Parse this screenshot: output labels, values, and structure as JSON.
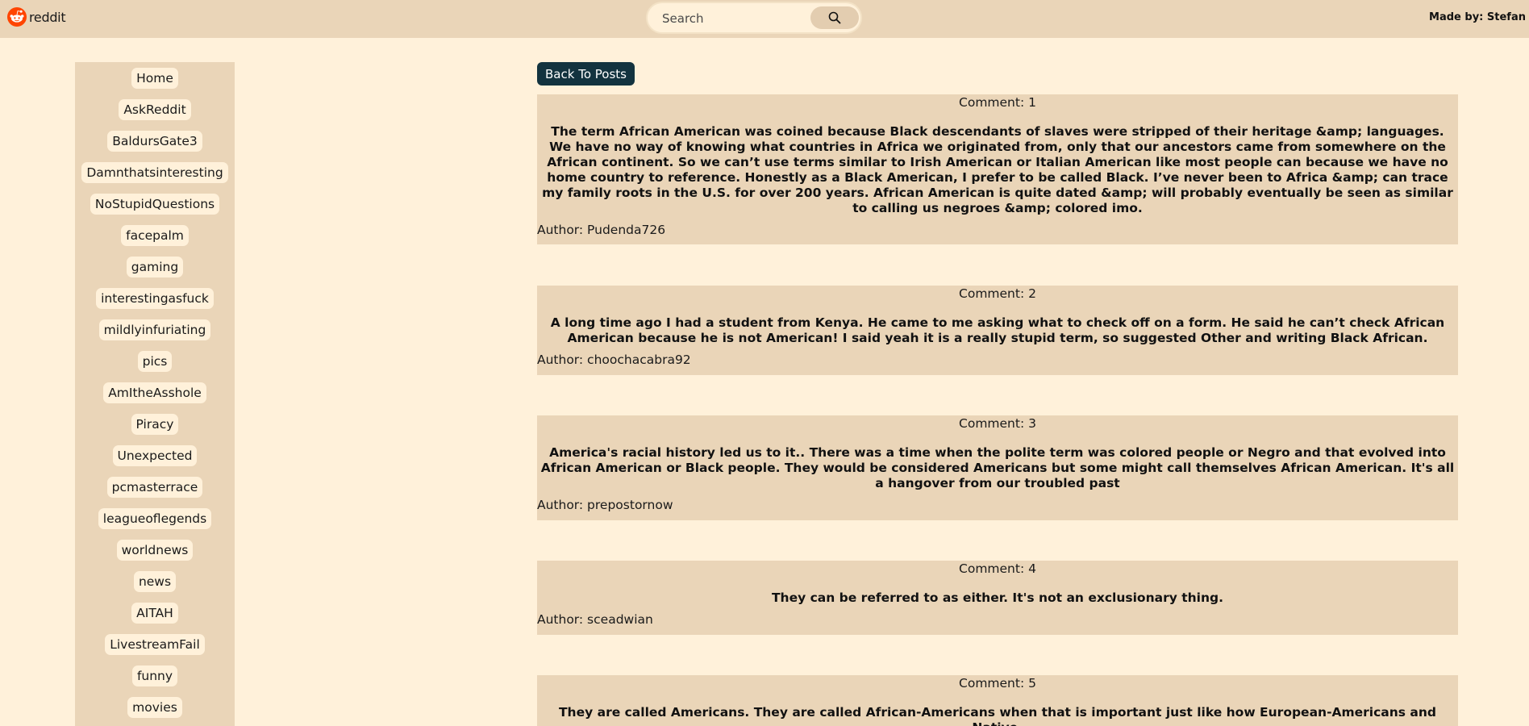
{
  "header": {
    "logo_text": "reddit",
    "logo_icon": "reddit-alien-icon",
    "brand_color": "#ff4500",
    "search_placeholder": "Search",
    "search_value": "",
    "search_icon": "search-icon",
    "made_by": "Made by: Stefan"
  },
  "sidebar": {
    "items": [
      {
        "label": "Home"
      },
      {
        "label": "AskReddit"
      },
      {
        "label": "BaldursGate3"
      },
      {
        "label": "Damnthatsinteresting"
      },
      {
        "label": "NoStupidQuestions"
      },
      {
        "label": "facepalm"
      },
      {
        "label": "gaming"
      },
      {
        "label": "interestingasfuck"
      },
      {
        "label": "mildlyinfuriating"
      },
      {
        "label": "pics"
      },
      {
        "label": "AmItheAsshole"
      },
      {
        "label": "Piracy"
      },
      {
        "label": "Unexpected"
      },
      {
        "label": "pcmasterrace"
      },
      {
        "label": "leagueoflegends"
      },
      {
        "label": "worldnews"
      },
      {
        "label": "news"
      },
      {
        "label": "AITAH"
      },
      {
        "label": "LivestreamFail"
      },
      {
        "label": "funny"
      },
      {
        "label": "movies"
      }
    ]
  },
  "main": {
    "back_label": "Back To Posts",
    "comments": [
      {
        "number": "Comment: 1",
        "body": "The term African American was coined because Black descendants of slaves were stripped of their heritage &amp; languages. We have no way of knowing what countries in Africa we originated from, only that our ancestors came from somewhere on the African continent. So we can’t use terms similar to Irish American or Italian American like most people can because we have no home country to reference. Honestly as a Black American, I prefer to be called Black. I’ve never been to Africa &amp; can trace my family roots in the U.S. for over 200 years. African American is quite dated &amp; will probably eventually be seen as similar to calling us negroes &amp; colored imo.",
        "author": "Author: Pudenda726"
      },
      {
        "number": "Comment: 2",
        "body": "A long time ago I had a student from Kenya. He came to me asking what to check off on a form. He said he can’t check African American because he is not American! I said yeah it is a really stupid term, so suggested Other and writing Black African.",
        "author": "Author: choochacabra92"
      },
      {
        "number": "Comment: 3",
        "body": "America's racial history led us to it.. There was a time when the polite term was colored people or Negro and that evolved into African American or Black people. They would be considered Americans but some might call themselves African American. It's all a hangover from our troubled past",
        "author": "Author: prepostornow"
      },
      {
        "number": "Comment: 4",
        "body": "They can be referred to as either. It's not an exclusionary thing.",
        "author": "Author: sceadwian"
      },
      {
        "number": "Comment: 5",
        "body": "They are called Americans. They are called African-Americans when that is important just like how European-Americans and Native-",
        "author": ""
      }
    ]
  }
}
